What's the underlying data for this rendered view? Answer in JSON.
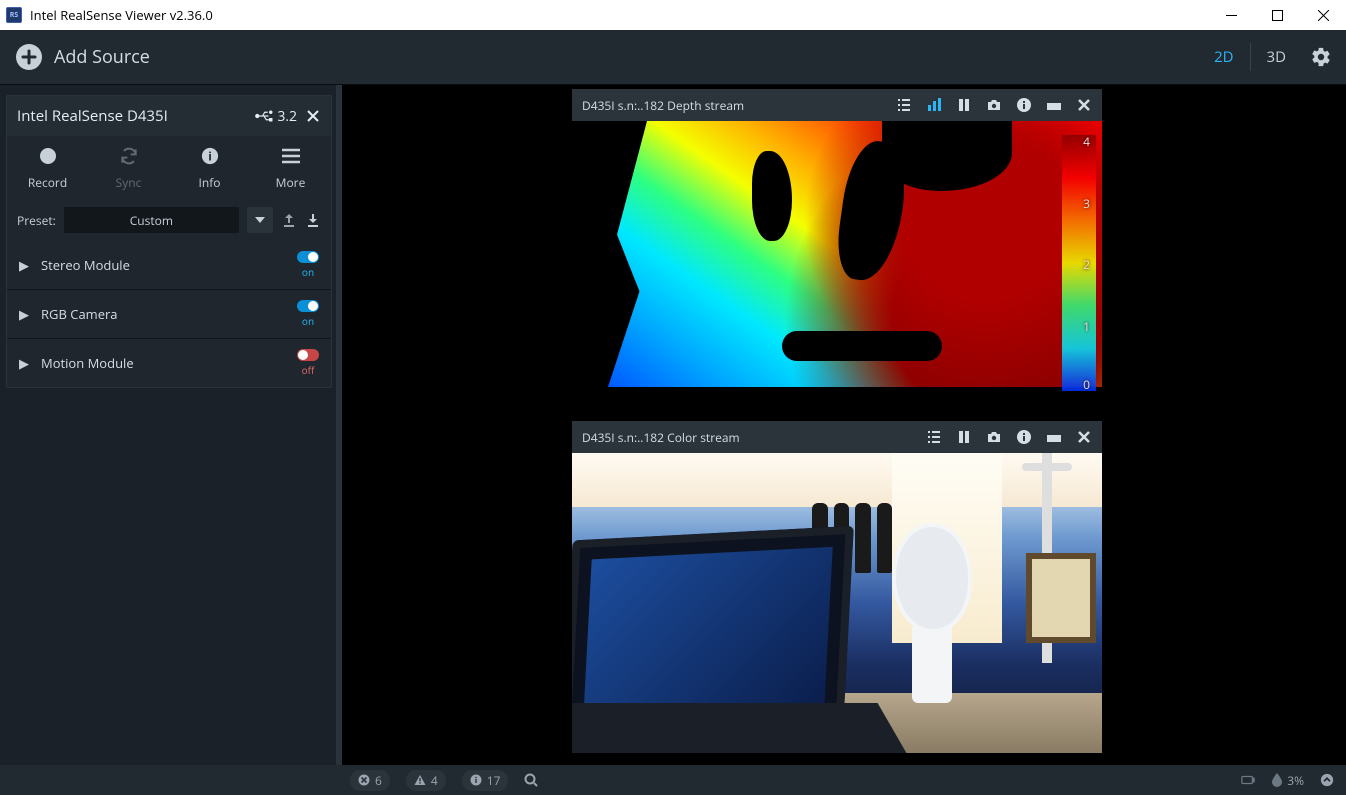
{
  "window": {
    "title": "Intel RealSense Viewer v2.36.0",
    "icon_text": "RS"
  },
  "topbar": {
    "add_source": "Add Source",
    "mode_2d": "2D",
    "mode_3d": "3D"
  },
  "device": {
    "name": "Intel RealSense D435I",
    "usb_version": "3.2",
    "actions": {
      "record": "Record",
      "sync": "Sync",
      "info": "Info",
      "more": "More"
    },
    "preset": {
      "label": "Preset:",
      "value": "Custom"
    },
    "modules": [
      {
        "name": "Stereo Module",
        "state": "on"
      },
      {
        "name": "RGB Camera",
        "state": "on"
      },
      {
        "name": "Motion Module",
        "state": "off"
      }
    ]
  },
  "streams": {
    "depth": {
      "title": "D435I s.n:..182 Depth stream",
      "scale_ticks": [
        "0",
        "1",
        "2",
        "3",
        "4"
      ]
    },
    "color": {
      "title": "D435I s.n:..182 Color stream"
    }
  },
  "status": {
    "errors": "6",
    "warnings": "4",
    "infos": "17",
    "humidity": "3%"
  }
}
